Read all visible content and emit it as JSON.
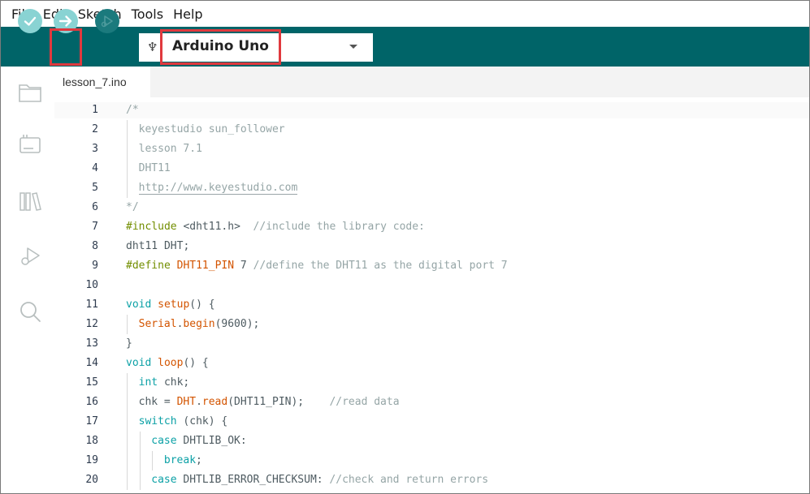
{
  "menu": {
    "items": [
      "File",
      "Edit",
      "Sketch",
      "Tools",
      "Help"
    ]
  },
  "toolbar": {
    "verify_icon": "check-icon",
    "upload_icon": "arrow-right-icon",
    "debug_icon": "debug-icon",
    "board_icon": "usb-icon",
    "board_name": "Arduino Uno",
    "accent_color": "#006468",
    "highlight_color": "#e0393e"
  },
  "sidebar": {
    "icons": [
      "folder-icon",
      "board-manager-icon",
      "library-icon",
      "debug-icon",
      "search-icon"
    ]
  },
  "tabs": [
    {
      "label": "lesson_7.ino"
    }
  ],
  "editor": {
    "lines": [
      {
        "n": "1",
        "indent": 0,
        "tokens": [
          {
            "t": "/*",
            "c": "comment"
          }
        ]
      },
      {
        "n": "2",
        "indent": 2,
        "tokens": [
          {
            "t": "keyestudio sun_follower",
            "c": "comment"
          }
        ]
      },
      {
        "n": "3",
        "indent": 2,
        "tokens": [
          {
            "t": "lesson 7.1",
            "c": "comment"
          }
        ]
      },
      {
        "n": "4",
        "indent": 2,
        "tokens": [
          {
            "t": "DHT11",
            "c": "comment"
          }
        ]
      },
      {
        "n": "5",
        "indent": 2,
        "tokens": [
          {
            "t": "http://www.keyestudio.com",
            "c": "comment-link"
          }
        ]
      },
      {
        "n": "6",
        "indent": 0,
        "tokens": [
          {
            "t": "*/",
            "c": "comment"
          }
        ]
      },
      {
        "n": "7",
        "indent": 0,
        "tokens": [
          {
            "t": "#include ",
            "c": "pre"
          },
          {
            "t": "<dht11.h>",
            "c": "plain"
          },
          {
            "t": "  //include the library code:",
            "c": "comment"
          }
        ]
      },
      {
        "n": "8",
        "indent": 0,
        "tokens": [
          {
            "t": "dht11 DHT;",
            "c": "plain"
          }
        ]
      },
      {
        "n": "9",
        "indent": 0,
        "tokens": [
          {
            "t": "#define ",
            "c": "pre"
          },
          {
            "t": "DHT11_PIN",
            "c": "red"
          },
          {
            "t": " 7 ",
            "c": "plain"
          },
          {
            "t": "//define the DHT11 as the digital port 7",
            "c": "comment"
          }
        ]
      },
      {
        "n": "10",
        "indent": 0,
        "tokens": []
      },
      {
        "n": "11",
        "indent": 0,
        "tokens": [
          {
            "t": "void ",
            "c": "kw"
          },
          {
            "t": "setup",
            "c": "fn"
          },
          {
            "t": "() {",
            "c": "plain"
          }
        ]
      },
      {
        "n": "12",
        "indent": 2,
        "tokens": [
          {
            "t": "Serial",
            "c": "fn"
          },
          {
            "t": ".",
            "c": "plain"
          },
          {
            "t": "begin",
            "c": "fn"
          },
          {
            "t": "(9600);",
            "c": "plain"
          }
        ]
      },
      {
        "n": "13",
        "indent": 0,
        "tokens": [
          {
            "t": "}",
            "c": "plain"
          }
        ]
      },
      {
        "n": "14",
        "indent": 0,
        "tokens": [
          {
            "t": "void ",
            "c": "kw"
          },
          {
            "t": "loop",
            "c": "fn"
          },
          {
            "t": "() {",
            "c": "plain"
          }
        ]
      },
      {
        "n": "15",
        "indent": 2,
        "tokens": [
          {
            "t": "int ",
            "c": "kw"
          },
          {
            "t": "chk;",
            "c": "plain"
          }
        ]
      },
      {
        "n": "16",
        "indent": 2,
        "tokens": [
          {
            "t": "chk = ",
            "c": "plain"
          },
          {
            "t": "DHT",
            "c": "red"
          },
          {
            "t": ".",
            "c": "plain"
          },
          {
            "t": "read",
            "c": "fn"
          },
          {
            "t": "(DHT11_PIN);",
            "c": "plain"
          },
          {
            "t": "    //read data",
            "c": "comment"
          }
        ]
      },
      {
        "n": "17",
        "indent": 2,
        "tokens": [
          {
            "t": "switch ",
            "c": "kw"
          },
          {
            "t": "(chk) {",
            "c": "plain"
          }
        ]
      },
      {
        "n": "18",
        "indent": 4,
        "tokens": [
          {
            "t": "case ",
            "c": "kw"
          },
          {
            "t": "DHTLIB_OK:",
            "c": "plain"
          }
        ]
      },
      {
        "n": "19",
        "indent": 6,
        "tokens": [
          {
            "t": "break",
            "c": "kw"
          },
          {
            "t": ";",
            "c": "plain"
          }
        ]
      },
      {
        "n": "20",
        "indent": 4,
        "tokens": [
          {
            "t": "case ",
            "c": "kw"
          },
          {
            "t": "DHTLIB_ERROR_CHECKSUM:",
            "c": "plain"
          },
          {
            "t": " //check and return errors",
            "c": "comment"
          }
        ]
      }
    ]
  }
}
